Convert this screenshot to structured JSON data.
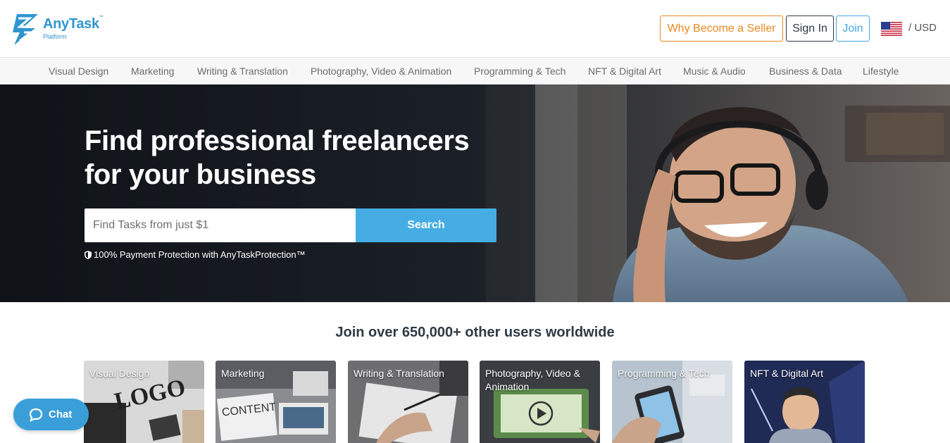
{
  "header": {
    "logo_name": "AnyTask",
    "logo_tm": "™",
    "logo_sub": "Platform",
    "seller_label": "Why Become a Seller",
    "signin_label": "Sign In",
    "join_label": "Join",
    "currency": "/ USD"
  },
  "categories": [
    "Visual Design",
    "Marketing",
    "Writing & Translation",
    "Photography, Video & Animation",
    "Programming & Tech",
    "NFT & Digital Art",
    "Music & Audio",
    "Business & Data",
    "Lifestyle"
  ],
  "hero": {
    "title_line1": "Find professional freelancers",
    "title_line2": "for your business",
    "search_placeholder": "Find Tasks from just $1",
    "search_label": "Search",
    "protection": "100% Payment Protection with AnyTaskProtection™"
  },
  "join": {
    "title": "Join over 650,000+ other users worldwide"
  },
  "cards": [
    "Visual Design",
    "Marketing",
    "Writing & Translation",
    "Photography, Video & Animation",
    "Programming & Tech",
    "NFT & Digital Art"
  ],
  "chat": {
    "label": "Chat"
  },
  "colors": {
    "brand": "#2f95cf",
    "search_button": "#45ade4",
    "seller_accent": "#e8891f"
  }
}
